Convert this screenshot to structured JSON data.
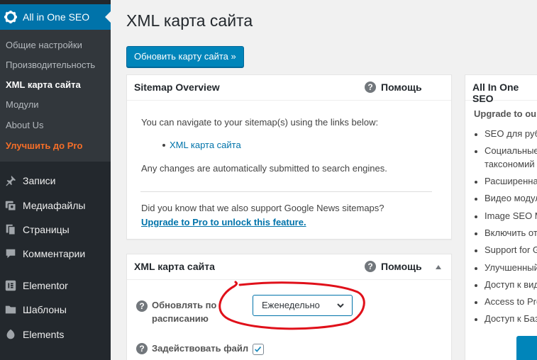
{
  "sidebar": {
    "plugin_title": "All in One SEO",
    "submenu": [
      {
        "label": "Общие настройки"
      },
      {
        "label": "Производительность"
      },
      {
        "label": "XML карта сайта"
      },
      {
        "label": "Модули"
      },
      {
        "label": "About Us"
      },
      {
        "label": "Улучшить до Pro"
      }
    ],
    "menu": [
      {
        "label": "Записи",
        "icon": "pin-icon"
      },
      {
        "label": "Медиафайлы",
        "icon": "media-icon"
      },
      {
        "label": "Страницы",
        "icon": "pages-icon"
      },
      {
        "label": "Комментарии",
        "icon": "comments-icon"
      },
      {
        "label": "Elementor",
        "icon": "elementor-icon"
      },
      {
        "label": "Шаблоны",
        "icon": "folder-icon"
      },
      {
        "label": "Elements",
        "icon": "elements-icon"
      }
    ]
  },
  "page": {
    "title": "XML карта сайта",
    "update_button": "Обновить карту сайта »"
  },
  "overview_box": {
    "title": "Sitemap Overview",
    "help_label": "Помощь",
    "intro": "You can navigate to your sitemap(s) using the links below:",
    "link": "XML карта сайта",
    "note": "Any changes are automatically submitted to search engines.",
    "news_text": "Did you know that we also support Google News sitemaps?",
    "upgrade_link": "Upgrade to Pro to unlock this feature."
  },
  "sitemap_box": {
    "title": "XML карта сайта",
    "help_label": "Помощь",
    "schedule_label": "Обновлять по расписанию",
    "schedule_value": "Еженедельно",
    "sitemap_file_label": "Задействовать файл"
  },
  "promo_box": {
    "title": "All In One SEO",
    "subtitle": "Upgrade to our",
    "items": [
      "SEO для рубр",
      "Социальные",
      "таксономий",
      "Расширенна",
      "Видео модул",
      "Image SEO M",
      "Включить от",
      "Support for G",
      "Улучшенный",
      "Доступ к вид",
      "Access to Pre",
      "Доступ к Баз"
    ]
  },
  "colors": {
    "accent": "#0073aa",
    "sidebar_bg": "#23282d",
    "pro_orange": "#f56e28",
    "annotation_red": "#e0101a"
  }
}
